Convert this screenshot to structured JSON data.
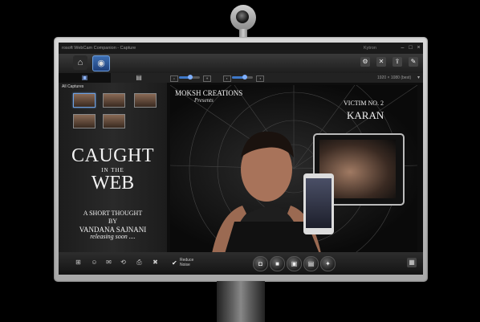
{
  "window": {
    "title": "rosoft WebCam Companion - Capture",
    "brand": "Kytron"
  },
  "toolbar": {
    "home_icon": "home-icon",
    "capture_icon": "camera-icon",
    "right_icons": [
      "settings-icon",
      "tools-icon",
      "upload-icon",
      "share-icon"
    ]
  },
  "left_tabs": {
    "active_icon": "capture-icon",
    "other_icon": "gallery-icon"
  },
  "controls": {
    "slider1_value": 0.55,
    "slider2_value": 0.6,
    "resolution": "1920 × 1080 (best)"
  },
  "sidebar": {
    "header": "All Captures"
  },
  "poster": {
    "title_line1": "CAUGHT",
    "title_line2": "IN THE",
    "title_line3": "WEB",
    "subtitle1": "A SHORT THOUGHT",
    "subtitle2": "BY",
    "subtitle3": "VANDANA SAJNANI",
    "release": "releasing soon ...."
  },
  "preview": {
    "studio": "MOKSH CREATIONS",
    "presents": "Presents",
    "victim": "VICTIM NO. 2",
    "name": "KARAN"
  },
  "bottom": {
    "reduce_label": "Reduce Noise",
    "actions": [
      "camera-icon",
      "video-icon",
      "video-clip-icon",
      "sequence-icon",
      "effects-icon"
    ],
    "corner_icon": "gallery-icon"
  },
  "colors": {
    "accent": "#3e78c8",
    "background": "#000000",
    "bezel": "#c2c2c2"
  }
}
